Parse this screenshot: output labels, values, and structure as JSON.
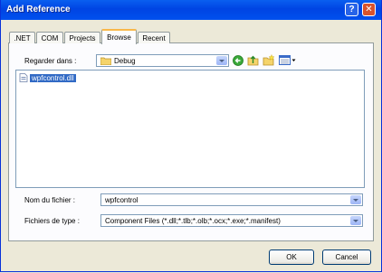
{
  "window": {
    "title": "Add Reference"
  },
  "tabs": [
    {
      "label": ".NET"
    },
    {
      "label": "COM"
    },
    {
      "label": "Projects"
    },
    {
      "label": "Browse"
    },
    {
      "label": "Recent"
    }
  ],
  "active_tab": "Browse",
  "browse": {
    "look_in_label": "Regarder dans :",
    "look_in_value": "Debug",
    "files": [
      {
        "name": "wpfcontrol.dll",
        "selected": true
      }
    ],
    "filename_label": "Nom du fichier :",
    "filename_value": "wpfcontrol",
    "filetype_label": "Fichiers de type :",
    "filetype_value": "Component Files (*.dll;*.tlb;*.olb;*.ocx;*.exe;*.manifest)"
  },
  "buttons": {
    "ok": "OK",
    "cancel": "Cancel"
  },
  "colors": {
    "titlebar": "#0054e3",
    "selection": "#316ac5",
    "active_tab_accent": "#f9b84a"
  }
}
